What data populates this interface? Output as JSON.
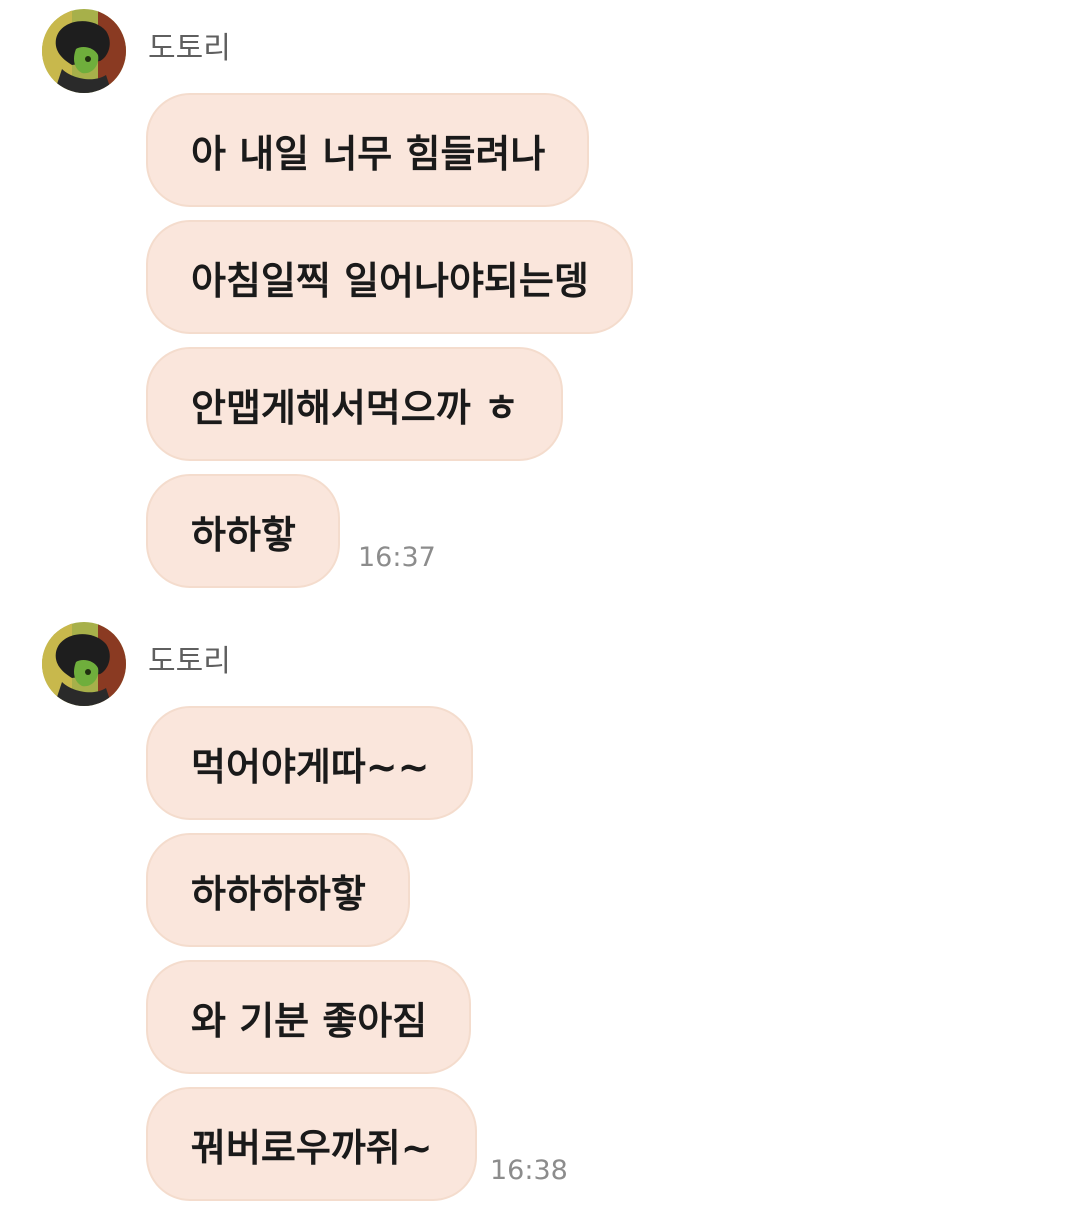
{
  "groups": [
    {
      "sender": "도토리",
      "avatar_icon": "profile-avatar",
      "messages": [
        "아 내일 너무 힘들려나",
        "아침일찍 일어나야되는뎅",
        "안맵게해서먹으까 ㅎ",
        "하하핳"
      ],
      "time": "16:37"
    },
    {
      "sender": "도토리",
      "avatar_icon": "profile-avatar",
      "messages": [
        "먹어야게따~~",
        "하하하하핳",
        "와 기분 좋아짐",
        "꿔버로우까쥐~"
      ],
      "time": "16:38"
    }
  ],
  "colors": {
    "bubble_bg": "#fae6dc",
    "bubble_border": "#f4dccd",
    "sender_text": "#5f5f5f",
    "time_text": "#8c8c8c"
  }
}
